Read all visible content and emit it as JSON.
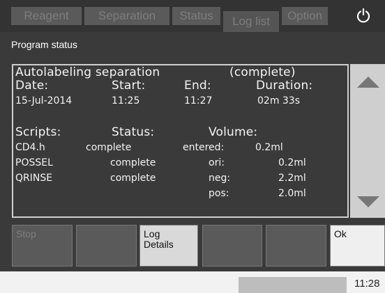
{
  "tabs": [
    "Reagent",
    "Separation",
    "Status",
    "Log list",
    "Option"
  ],
  "power_icon": "power-icon",
  "program_status_title": "Program status",
  "panel": {
    "title": "Autolabeling separation",
    "state": "(complete)",
    "headers": {
      "date": "Date:",
      "start": "Start:",
      "end": "End:",
      "duration": "Duration:"
    },
    "values": {
      "date": "15-Jul-2014",
      "start": "11:25",
      "end": "11:27",
      "duration": "02m 33s"
    },
    "col_headers": {
      "scripts": "Scripts:",
      "status": "Status:",
      "volume": "Volume:"
    },
    "scripts": [
      {
        "name": "CD4.h",
        "status": "complete"
      },
      {
        "name": "POSSEL",
        "status": "complete"
      },
      {
        "name": "QRINSE",
        "status": "complete"
      }
    ],
    "volumes": [
      {
        "label": "entered:",
        "value": "0.2ml"
      },
      {
        "label": "ori:",
        "value": "0.2ml"
      },
      {
        "label": "neg:",
        "value": "2.2ml"
      },
      {
        "label": "pos:",
        "value": "2.0ml"
      }
    ]
  },
  "scroll_icons": {
    "up": "arrow-up-icon",
    "down": "arrow-down-icon"
  },
  "buttons": {
    "stop": "Stop",
    "log_details_line1": "Log",
    "log_details_line2": "Details",
    "ok": "Ok"
  },
  "statusbar": {
    "time": "11:28"
  }
}
